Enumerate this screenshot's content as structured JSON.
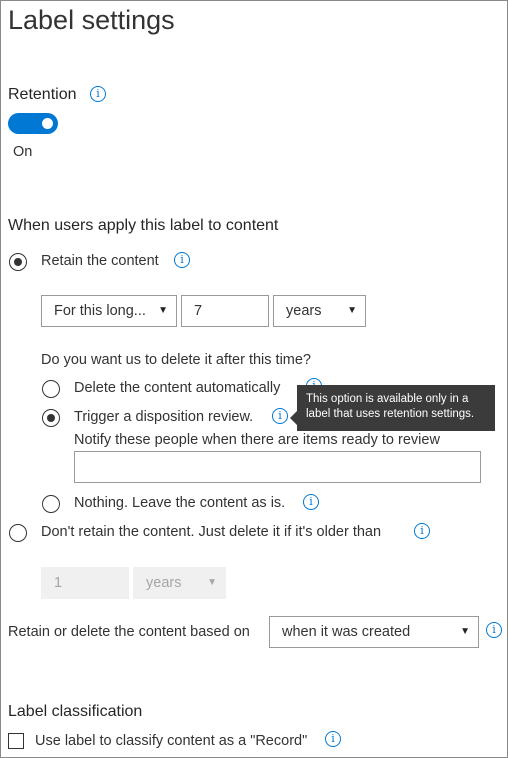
{
  "page_title": "Label settings",
  "retention": {
    "heading": "Retention",
    "toggle_state": "On"
  },
  "apply": {
    "heading": "When users apply this label to content",
    "retain_label": "Retain the content",
    "duration_mode": "For this long...",
    "duration_value": "7",
    "duration_unit": "years",
    "delete_question": "Do you want us to delete it after this time?",
    "delete_auto_label": "Delete the content automatically",
    "disposition_label": "Trigger a disposition review.",
    "notify_label": "Notify these people when there are items ready to review",
    "notify_value": "",
    "nothing_label": "Nothing. Leave the content as is.",
    "dont_retain_label": "Don't retain the content. Just delete it if it's older than",
    "dont_retain_value": "1",
    "dont_retain_unit": "years",
    "based_on_label": "Retain or delete the content based on",
    "based_on_value": "when it was created"
  },
  "tooltip_text": "This option is available only in a label that uses retention settings.",
  "classification": {
    "heading": "Label classification",
    "record_label": "Use label to classify content as a \"Record\""
  },
  "icons": {
    "info": "info-icon",
    "caret": "caret-down-icon"
  },
  "colors": {
    "accent": "#0078d4",
    "tooltip_bg": "#3b3b3b"
  }
}
